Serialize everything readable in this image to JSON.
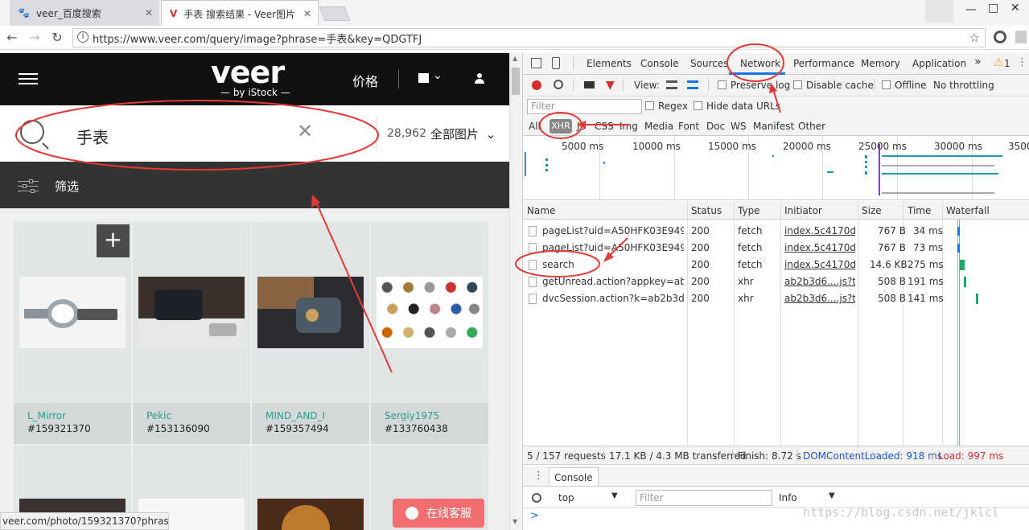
{
  "browser": {
    "tabs": [
      {
        "title": "veer_百度搜索",
        "favicon": "baidu-paw-icon"
      },
      {
        "title": "手表 搜索结果 - Veer图片",
        "favicon": "veer-v-icon"
      }
    ],
    "url": "https://www.veer.com/query/image?phrase=手表&key=QDGTFJ"
  },
  "veer": {
    "logo": "veer",
    "logo_sub": "— by iStock —",
    "price_label": "价格",
    "search_term": "手表",
    "result_count": "28,962",
    "result_type": "全部图片",
    "filter_label": "筛选",
    "cards": [
      {
        "author": "L_Mirror",
        "number": "#159321370"
      },
      {
        "author": "Pekic",
        "number": "#153136090"
      },
      {
        "author": "MIND_AND_I",
        "number": "#159357494"
      },
      {
        "author": "Sergiy1975",
        "number": "#133760438"
      }
    ],
    "live_chat": "在线客服",
    "status_url": "veer.com/photo/159321370?phras..."
  },
  "devtools": {
    "tabs": [
      "Elements",
      "Console",
      "Sources",
      "Network",
      "Performance",
      "Memory",
      "Application"
    ],
    "more": "»",
    "warning_count": "1",
    "view_label": "View:",
    "preserve_log": "Preserve log",
    "disable_cache": "Disable cache",
    "offline": "Offline",
    "throttling": "No throttling",
    "filter_placeholder": "Filter",
    "regex": "Regex",
    "hide_data_urls": "Hide data URLs",
    "type_filters": [
      "All",
      "XHR",
      "JS",
      "CSS",
      "Img",
      "Media",
      "Font",
      "Doc",
      "WS",
      "Manifest",
      "Other"
    ],
    "timeline_labels": [
      "5000 ms",
      "10000 ms",
      "15000 ms",
      "20000 ms",
      "25000 ms",
      "30000 ms",
      "3500"
    ],
    "columns": [
      "Name",
      "Status",
      "Type",
      "Initiator",
      "Size",
      "Time",
      "Waterfall"
    ],
    "rows": [
      {
        "name": "pageList?uid=A50HFK03E949&...",
        "status": "200",
        "type": "fetch",
        "initiator": "index.5c4170d...",
        "size": "767 B",
        "time": "34 ms"
      },
      {
        "name": "pageList?uid=A50HFK03E949&...",
        "status": "200",
        "type": "fetch",
        "initiator": "index.5c4170d...",
        "size": "767 B",
        "time": "73 ms"
      },
      {
        "name": "search",
        "status": "200",
        "type": "fetch",
        "initiator": "index.5c4170d...",
        "size": "14.6 KB",
        "time": "275 ms"
      },
      {
        "name": "getUnread.action?appkey=ab2b...",
        "status": "200",
        "type": "xhr",
        "initiator": "ab2b3d6....js?t...",
        "size": "508 B",
        "time": "191 ms"
      },
      {
        "name": "dvcSession.action?k=ab2b3d6d...",
        "status": "200",
        "type": "xhr",
        "initiator": "ab2b3d6....js?t...",
        "size": "508 B",
        "time": "141 ms"
      }
    ],
    "status_requests": "5 / 157 requests",
    "status_transferred": "17.1 KB / 4.3 MB transferred",
    "status_finish": "Finish: 8.72 s",
    "status_dcl": "DOMContentLoaded: 918 ms",
    "status_load": "Load: 997 ms",
    "console_tab": "Console",
    "console_context": "top",
    "console_filter": "Filter",
    "console_level": "Info",
    "console_prompt": ">"
  },
  "watermark": "https://blog.csdn.net/jklcl",
  "colors": {
    "annotation": "#e53935",
    "record": "#d32f2f",
    "dcl": "#1a56c9",
    "load": "#d32f2f",
    "author": "#2a9d8f"
  }
}
